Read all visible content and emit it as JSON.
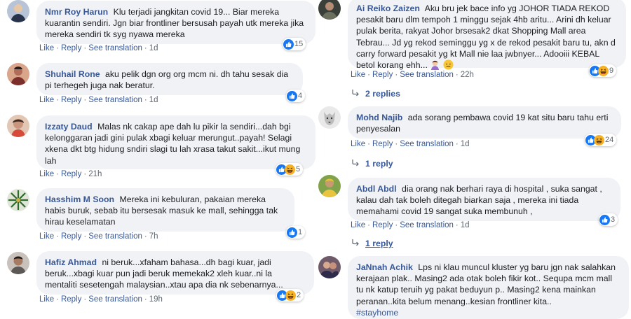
{
  "actions": {
    "like": "Like",
    "reply": "Reply",
    "see_translation": "See translation",
    "sep": "·"
  },
  "left": [
    {
      "author": "Nmr Roy Harun",
      "text": "Klu terjadi jangkitan covid 19... Biar mereka kuarantin sendiri. Jgn biar frontliner bersusah payah utk mereka jika mereka sendiri tk syg nyawa mereka",
      "time": "1d",
      "reactions": "15"
    },
    {
      "author": "Shuhail Rone",
      "text": "aku pelik dgn org org mcm ni. dh tahu sesak dia pi terhegeh juga nak beratur.",
      "time": "1d",
      "reactions": "4"
    },
    {
      "author": "Izzaty Daud",
      "text": "Malas nk cakap ape dah lu pikir la sendiri...dah bgi kelonggaran jadi gini pulak xbagi keluar merungut..payah! Selagi xkena dkt btg hidung sndiri slagi tu lah xrasa takut sakit...ikut mung lah",
      "time": "21h",
      "reactions": "5"
    },
    {
      "author": "Hasshim M Soon",
      "text": "Mereka ini kebuluran, pakaian mereka habis buruk, sebab itu bersesak masuk ke mall, sehingga tak hirau keselamatan",
      "time": "7h",
      "reactions": "1"
    },
    {
      "author": "Hafiz Ahmad",
      "text": "ni beruk...xfaham bahasa...dh bagi kuar, jadi beruk...xbagi kuar pun jadi beruk memekak2 xleh kuar..ni la mentaliti sesetengah malaysian..xtau apa dia nk sebenarnya...",
      "time": "19h",
      "reactions": "2"
    }
  ],
  "right": [
    {
      "author": "Ai Reiko Zaizen",
      "text": "Aku bru jek bace info yg JOHOR TIADA REKOD pesakit baru dlm tempoh 1 minggu sejak 4hb aritu... Arini dh keluar pulak berita, rakyat Johor brsesak2 dkat Shopping Mall area Tebrau... Jd yg rekod seminggu yg x de rekod pesakit baru tu, akn d carry forward pesakit yg kt Mall nie laa jwbnyer... Adooiii KEBAL betol korang ehh...",
      "time": "22h",
      "reactions": "9",
      "replies": "2 replies"
    },
    {
      "author": "Mohd Najib",
      "text": "ada sorang pembawa covid 19 kat situ baru tahu erti penyesalan",
      "time": "1d",
      "reactions": "24",
      "replies": "1 reply"
    },
    {
      "author": "Abdl Abdl",
      "text": "dia orang nak berhari raya di hospital , suka sangat , kalau dah tak boleh ditegah biarkan saja , mereka ini tiada memahami covid 19 sangat suka membunuh ,",
      "time": "1d",
      "reactions": "3",
      "replies": "1 reply"
    },
    {
      "author": "JaNnah Achik",
      "text": "Lps ni klau muncul kluster yg baru jgn nak salahkan kerajaan plak.. Masing2 ada otak boleh fikir kot.. Sequpa mcm mall tu nk katup teruih yg pakat beduyun p.. Masing2 kena mainkan peranan..kita belum menang..kesian frontliner kita..",
      "hashtag": "#stayhome"
    }
  ],
  "colors": {
    "link": "#385898",
    "bubble": "#f0f2f5",
    "meta": "#606770",
    "like_blue": "#1877f2",
    "haha_yellow": "#f7b125",
    "angry_orange": "#e9710f"
  },
  "icons": [
    "like-icon",
    "haha-icon",
    "angry-icon",
    "reply-arrow-icon"
  ]
}
